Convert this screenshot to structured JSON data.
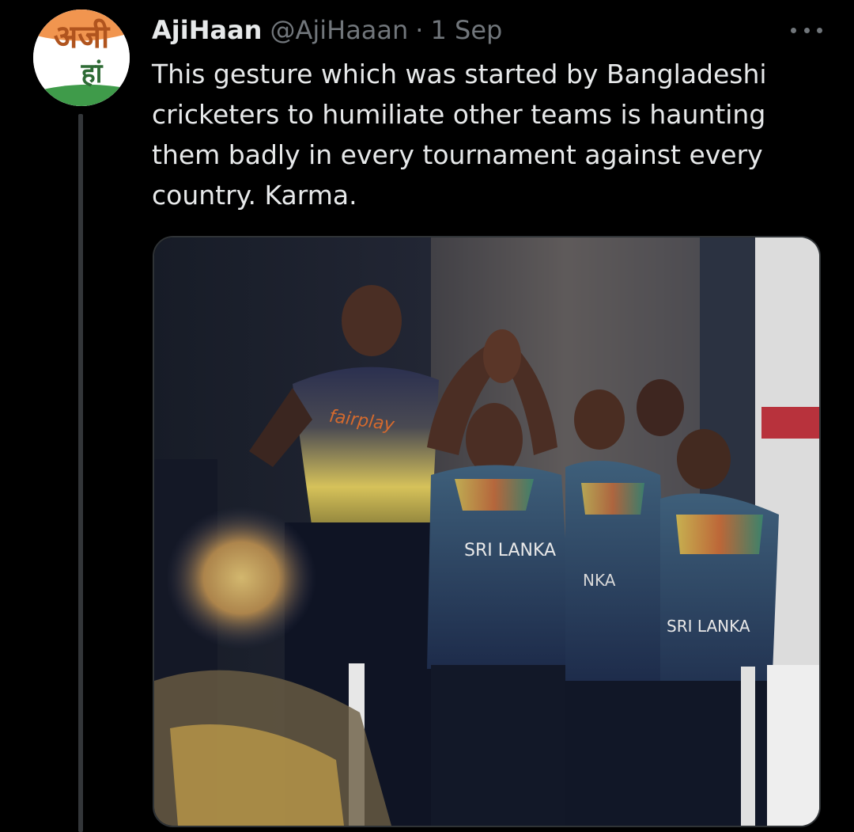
{
  "tweet": {
    "author": {
      "display_name": "AjiHaan",
      "handle": "@AjiHaaan",
      "avatar_text_top": "अजी",
      "avatar_text_bottom": "हां"
    },
    "separator": "·",
    "date": "1 Sep",
    "more_icon": "ellipsis-icon",
    "text": "This gesture which was started by Bangladeshi cricketers to humiliate other teams is haunting them badly in every tournament against every country. Karma.",
    "media": {
      "sponsor_text": "fairplay",
      "jersey_text_1": "SRI LANKA",
      "jersey_text_2": "NKA",
      "jersey_text_3": "SRI LANKA"
    }
  },
  "colors": {
    "background": "#000000",
    "primary_text": "#e7e9ea",
    "secondary_text": "#71767b",
    "thread_line": "#333639",
    "saffron": "#f08a3c",
    "green": "#3f9b4a"
  }
}
